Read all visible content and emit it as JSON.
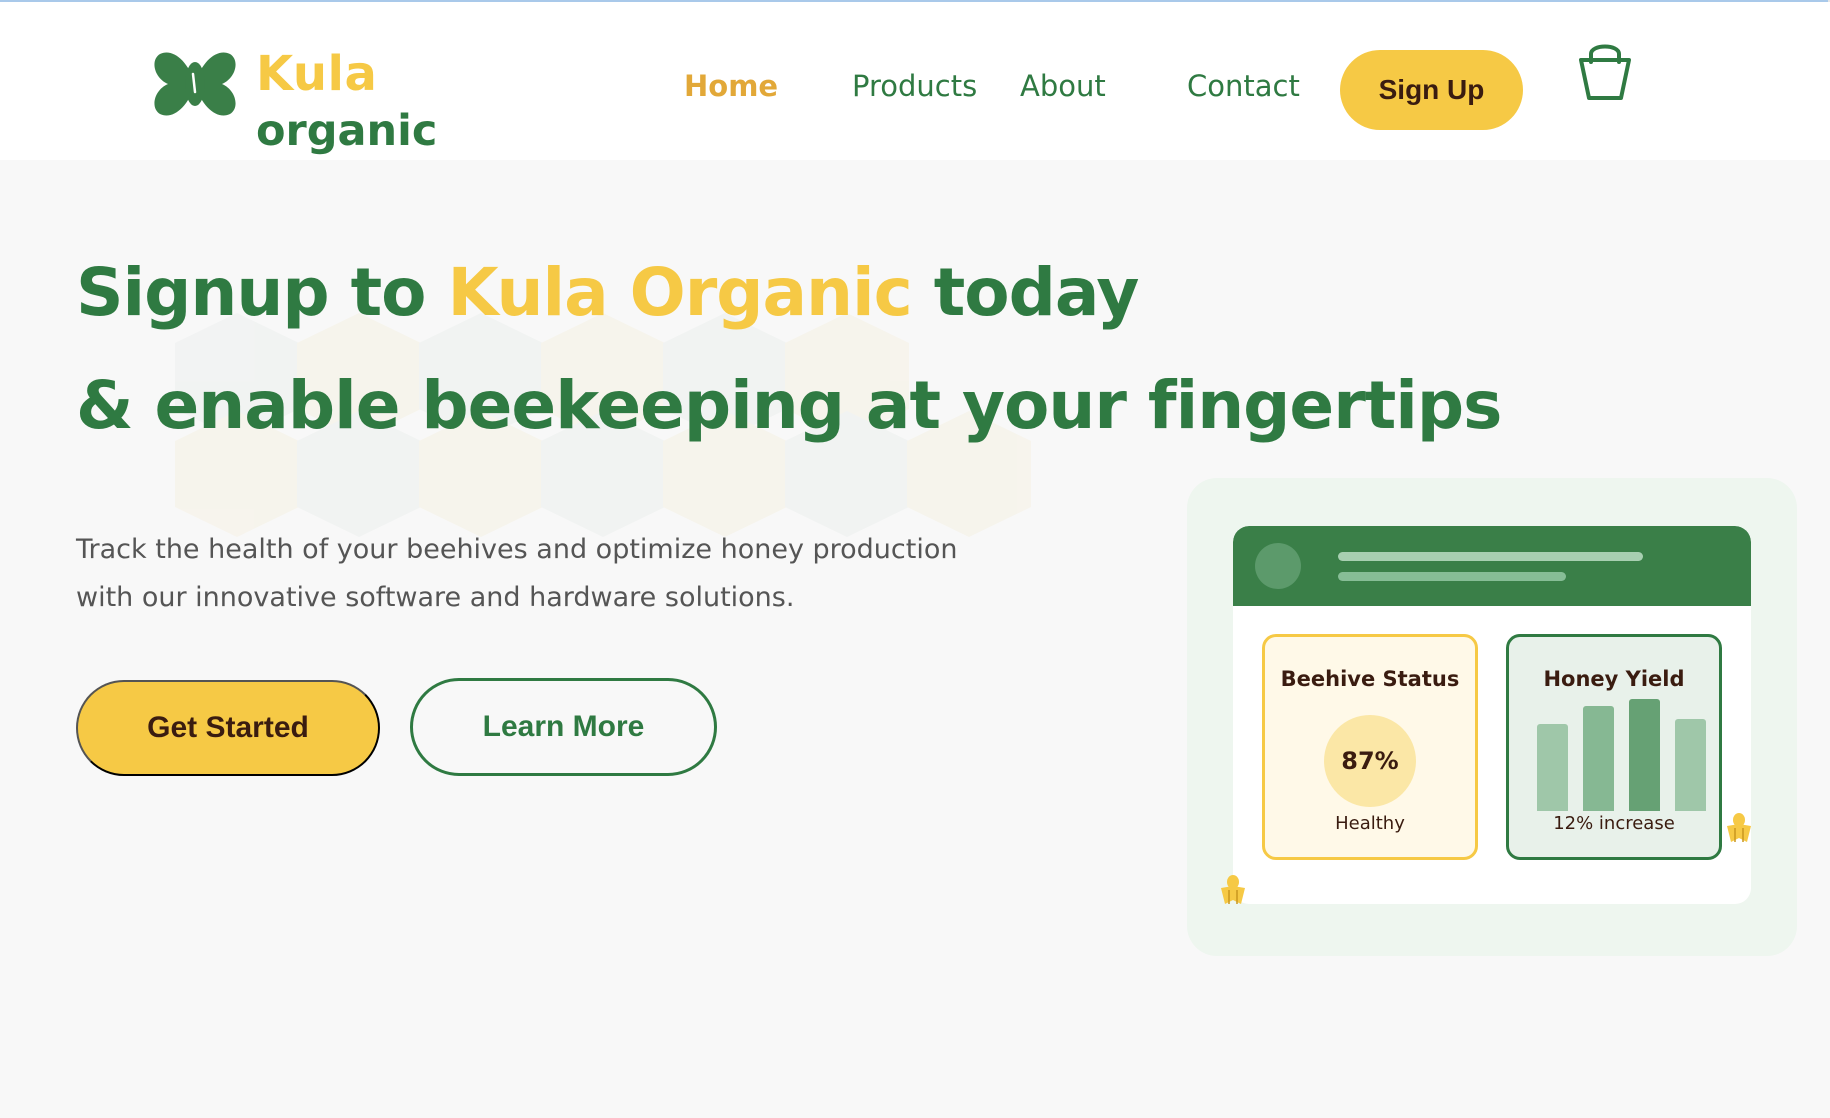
{
  "brand": {
    "name_top": "Kula",
    "name_bottom": "organic",
    "icon": "butterfly-leaf-logo-icon",
    "primary_color": "#2f7a42",
    "accent_color": "#f6c945"
  },
  "nav": {
    "items": [
      {
        "label": "Home",
        "active": true
      },
      {
        "label": "Products",
        "active": false
      },
      {
        "label": "About",
        "active": false
      },
      {
        "label": "Contact",
        "active": false
      }
    ],
    "signup_label": "Sign Up",
    "cart_icon": "basket-icon"
  },
  "hero": {
    "headline_part1": "Signup to",
    "headline_accent": "Kula Organic",
    "headline_part2": "today",
    "headline_line2": "& enable beekeeping at your fingertips",
    "subtext_line1": "Track the health of your beehives and optimize honey production",
    "subtext_line2": "with our innovative software and hardware solutions.",
    "primary_cta": "Get Started",
    "secondary_cta": "Learn More"
  },
  "dashboard": {
    "status": {
      "title": "Beehive Status",
      "value": "87%",
      "caption": "Healthy"
    },
    "yield": {
      "title": "Honey Yield",
      "caption": "12% increase",
      "bar_levels": [
        0.78,
        0.94,
        1.0,
        0.82
      ]
    },
    "bee_icon": "bee-icon"
  }
}
